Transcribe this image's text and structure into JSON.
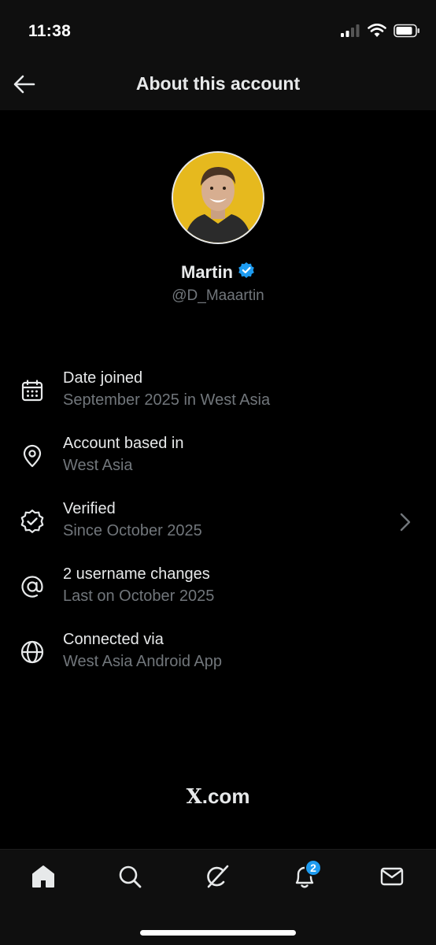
{
  "status_bar": {
    "time": "11:38",
    "icons": [
      "cellular-signal-icon",
      "wifi-icon",
      "battery-icon"
    ]
  },
  "header": {
    "title": "About this account",
    "back_icon": "arrow-left-icon"
  },
  "profile": {
    "name": "Martin",
    "handle": "@D_Maaartin",
    "verified": true,
    "verified_color": "#1d9bf0",
    "avatar_bg_color": "#e6b91e"
  },
  "info_items": [
    {
      "icon": "calendar-icon",
      "title": "Date joined",
      "subtitle": "September 2025 in West Asia"
    },
    {
      "icon": "location-pin-icon",
      "title": "Account based in",
      "subtitle": "West Asia"
    },
    {
      "icon": "verified-badge-icon",
      "title": "Verified",
      "subtitle": "Since October 2025"
    },
    {
      "icon": "at-sign-icon",
      "title": "2 username changes",
      "subtitle": "Last on October 2025"
    },
    {
      "icon": "globe-icon",
      "title": "Connected via",
      "subtitle": "West Asia Android App"
    }
  ],
  "brand": {
    "x": "X",
    "suffix": ".com"
  },
  "tab_bar": {
    "tabs": [
      {
        "icon": "home-icon",
        "active": true
      },
      {
        "icon": "search-icon",
        "active": false
      },
      {
        "icon": "grok-icon",
        "active": false
      },
      {
        "icon": "notifications-bell-icon",
        "active": false,
        "badge": "2"
      },
      {
        "icon": "messages-envelope-icon",
        "active": false
      }
    ]
  },
  "colors": {
    "background": "#000000",
    "bar_background": "#0f0f0f",
    "primary_text": "#e7e9ea",
    "secondary_text": "#71767b",
    "accent": "#1d9bf0"
  }
}
